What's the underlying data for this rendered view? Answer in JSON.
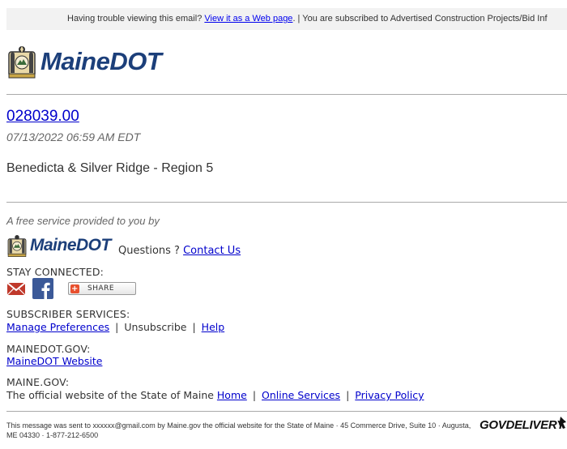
{
  "top_bar": {
    "prefix": "Having trouble viewing this email? ",
    "web_link": "View it as a Web page",
    "suffix": ". | You are subscribed to Advertised Construction Projects/Bid Inf"
  },
  "logo": {
    "wordmark": "MaineDOT"
  },
  "bulletin": {
    "project_number": "028039.00",
    "timestamp": "07/13/2022 06:59 AM EDT",
    "summary": "Benedicta & Silver Ridge - Region 5"
  },
  "footer": {
    "service_note": "A free service provided to you by",
    "questions_label": "Questions ? ",
    "contact_link": "Contact Us",
    "stay_connected_label": "STAY CONNECTED:",
    "share_label": "SHARE",
    "subscriber_services_label": "SUBSCRIBER SERVICES:",
    "manage_preferences": "Manage Preferences",
    "unsubscribe": "Unsubscribe",
    "help": "Help",
    "separator": "|",
    "mainedot_gov_label": "MAINEDOT.GOV:",
    "mainedot_website": "MaineDOT Website",
    "maine_gov_label": "MAINE.GOV:",
    "maine_gov_text": "The official website of the State of Maine ",
    "home": "Home",
    "online_services": "Online Services",
    "privacy_policy": "Privacy Policy",
    "legal_text": "This message was sent to xxxxxx@gmail.com by Maine.gov the official website for the State of Maine · 45 Commerce Drive, Suite 10 · Augusta, ME 04330 · 1-877-212-6500",
    "govdelivery": "GOVDELIVERY"
  },
  "colors": {
    "brand_blue": "#1c3f7a",
    "link_blue": "#0000cc",
    "top_bar_bg": "#f2f2f2",
    "email_red": "#c0392b",
    "facebook_blue": "#3b5998",
    "share_orange": "#e8502e"
  },
  "icons": {
    "seal": "maine-state-seal-icon",
    "email": "email-envelope-icon",
    "facebook": "facebook-icon",
    "share": "share-plus-icon",
    "govdelivery": "govdelivery-arrow-icon"
  }
}
